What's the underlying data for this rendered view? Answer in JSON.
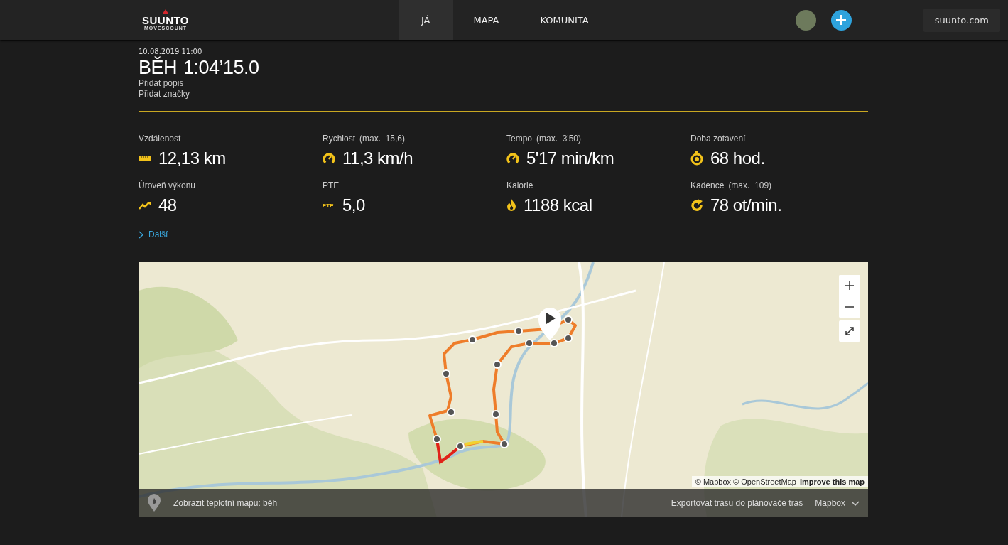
{
  "header": {
    "logo": {
      "brand": "SUUNTO",
      "sub": "MOVESCOUNT"
    },
    "tabs": [
      {
        "label": "JÁ",
        "selected": true
      },
      {
        "label": "MAPA",
        "selected": false
      },
      {
        "label": "KOMUNITA",
        "selected": false
      }
    ],
    "site_link": "suunto.com"
  },
  "activity": {
    "date": "10.08.2019 11:00",
    "sport": "BĚH",
    "duration": "1:04’15.0",
    "links": [
      "Přidat popis",
      "Přidat značky"
    ]
  },
  "stats": [
    {
      "kind": "distance",
      "label": "Vzdálenost",
      "value": "12,13 km"
    },
    {
      "kind": "speed",
      "label": "Rychlost",
      "max": "(max.  15,6)",
      "value": "11,3 km/h"
    },
    {
      "kind": "pace",
      "label": "Tempo",
      "max": "(max.  3'50)",
      "value": "5'17 min/km"
    },
    {
      "kind": "recovery",
      "label": "Doba zotavení",
      "value": "68 hod."
    },
    {
      "kind": "performance",
      "label": "Úroveň výkonu",
      "value": "48"
    },
    {
      "kind": "pte",
      "label": "PTE",
      "value": "5,0",
      "icon_text": "PTE"
    },
    {
      "kind": "calories",
      "label": "Kalorie",
      "value": "1188 kcal"
    },
    {
      "kind": "cadence",
      "label": "Kadence",
      "max": "(max.  109)",
      "value": "78 ot/min."
    }
  ],
  "more_link": "Další",
  "map": {
    "attribution": "© Mapbox © OpenStreetMap",
    "improve_link": "Improve this map",
    "heatmap_label": "Zobrazit teplotní mapu: běh",
    "export_link": "Exportovat trasu do plánovače tras",
    "style_select": "Mapbox"
  }
}
